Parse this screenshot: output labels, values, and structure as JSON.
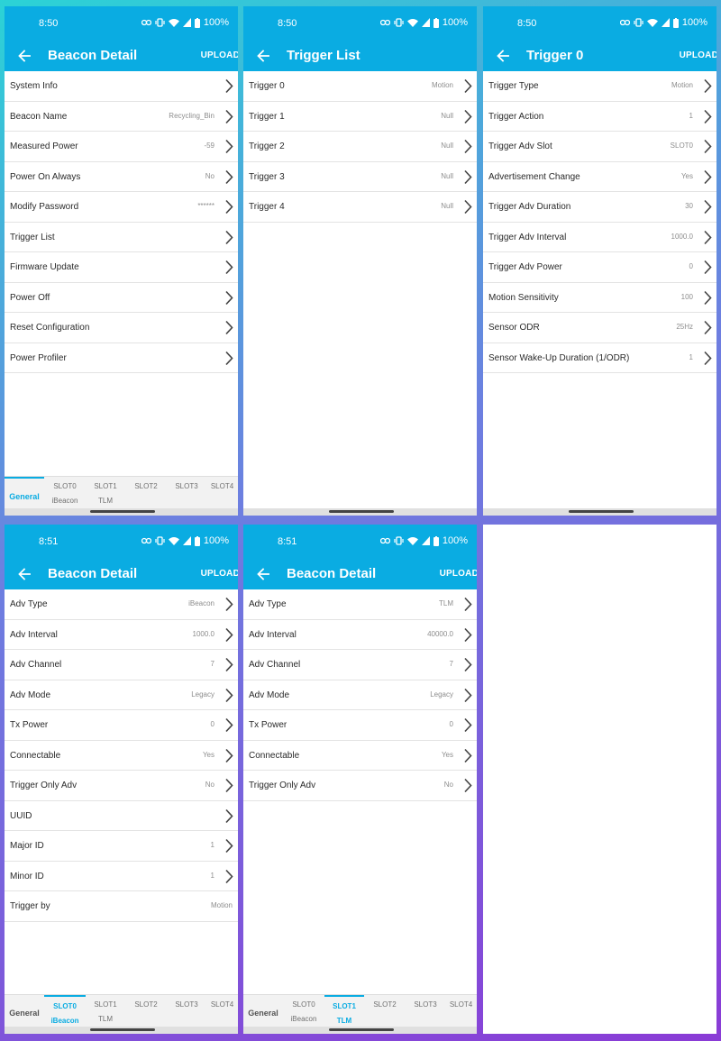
{
  "panels": [
    {
      "time": "8:50",
      "battery": "100%",
      "title": "Beacon Detail",
      "upload": "UPLOAD",
      "rows": [
        {
          "label": "System Info",
          "value": ""
        },
        {
          "label": "Beacon Name",
          "value": "Recycling_Bin"
        },
        {
          "label": "Measured Power",
          "value": "-59"
        },
        {
          "label": "Power On Always",
          "value": "No"
        },
        {
          "label": "Modify Password",
          "value": "******"
        },
        {
          "label": "Trigger List",
          "value": ""
        },
        {
          "label": "Firmware Update",
          "value": ""
        },
        {
          "label": "Power Off",
          "value": ""
        },
        {
          "label": "Reset Configuration",
          "value": ""
        },
        {
          "label": "Power Profiler",
          "value": ""
        }
      ],
      "tabs": [
        {
          "t1": "General",
          "t2": ""
        },
        {
          "t1": "SLOT0",
          "t2": "iBeacon"
        },
        {
          "t1": "SLOT1",
          "t2": "TLM"
        },
        {
          "t1": "SLOT2",
          "t2": ""
        },
        {
          "t1": "SLOT3",
          "t2": ""
        },
        {
          "t1": "SLOT4",
          "t2": ""
        }
      ],
      "active_tab": 0
    },
    {
      "time": "8:50",
      "battery": "100%",
      "title": "Trigger List",
      "upload": "",
      "rows": [
        {
          "label": "Trigger 0",
          "value": "Motion"
        },
        {
          "label": "Trigger 1",
          "value": "Null"
        },
        {
          "label": "Trigger 2",
          "value": "Null"
        },
        {
          "label": "Trigger 3",
          "value": "Null"
        },
        {
          "label": "Trigger 4",
          "value": "Null"
        }
      ]
    },
    {
      "time": "8:50",
      "battery": "100%",
      "title": "Trigger 0",
      "upload": "UPLOAD",
      "rows": [
        {
          "label": "Trigger Type",
          "value": "Motion"
        },
        {
          "label": "Trigger Action",
          "value": "1"
        },
        {
          "label": "Trigger Adv Slot",
          "value": "SLOT0"
        },
        {
          "label": "Advertisement Change",
          "value": "Yes"
        },
        {
          "label": "Trigger Adv Duration",
          "value": "30"
        },
        {
          "label": "Trigger Adv Interval",
          "value": "1000.0"
        },
        {
          "label": "Trigger Adv Power",
          "value": "0"
        },
        {
          "label": "Motion Sensitivity",
          "value": "100"
        },
        {
          "label": "Sensor ODR",
          "value": "25Hz"
        },
        {
          "label": "Sensor Wake-Up Duration (1/ODR)",
          "value": "1"
        }
      ]
    },
    {
      "time": "8:51",
      "battery": "100%",
      "title": "Beacon Detail",
      "upload": "UPLOAD",
      "rows": [
        {
          "label": "Adv Type",
          "value": "iBeacon"
        },
        {
          "label": "Adv Interval",
          "value": "1000.0"
        },
        {
          "label": "Adv Channel",
          "value": "7"
        },
        {
          "label": "Adv Mode",
          "value": "Legacy"
        },
        {
          "label": "Tx Power",
          "value": "0"
        },
        {
          "label": "Connectable",
          "value": "Yes"
        },
        {
          "label": "Trigger Only Adv",
          "value": "No"
        },
        {
          "label": "UUID",
          "value": ""
        },
        {
          "label": "Major ID",
          "value": "1"
        },
        {
          "label": "Minor ID",
          "value": "1"
        },
        {
          "label": "Trigger by",
          "value": "Motion"
        }
      ],
      "tabs": [
        {
          "t1": "General",
          "t2": ""
        },
        {
          "t1": "SLOT0",
          "t2": "iBeacon"
        },
        {
          "t1": "SLOT1",
          "t2": "TLM"
        },
        {
          "t1": "SLOT2",
          "t2": ""
        },
        {
          "t1": "SLOT3",
          "t2": ""
        },
        {
          "t1": "SLOT4",
          "t2": ""
        }
      ],
      "active_tab": 1
    },
    {
      "time": "8:51",
      "battery": "100%",
      "title": "Beacon Detail",
      "upload": "UPLOAD",
      "rows": [
        {
          "label": "Adv Type",
          "value": "TLM"
        },
        {
          "label": "Adv Interval",
          "value": "40000.0"
        },
        {
          "label": "Adv Channel",
          "value": "7"
        },
        {
          "label": "Adv Mode",
          "value": "Legacy"
        },
        {
          "label": "Tx Power",
          "value": "0"
        },
        {
          "label": "Connectable",
          "value": "Yes"
        },
        {
          "label": "Trigger Only Adv",
          "value": "No"
        }
      ],
      "tabs": [
        {
          "t1": "General",
          "t2": ""
        },
        {
          "t1": "SLOT0",
          "t2": "iBeacon"
        },
        {
          "t1": "SLOT1",
          "t2": "TLM"
        },
        {
          "t1": "SLOT2",
          "t2": ""
        },
        {
          "t1": "SLOT3",
          "t2": ""
        },
        {
          "t1": "SLOT4",
          "t2": ""
        }
      ],
      "active_tab": 2
    }
  ],
  "colors": {
    "accent": "#0aace2"
  },
  "icons": [
    "back-arrow-icon",
    "chevron-right-icon",
    "link-icon",
    "vibrate-icon",
    "wifi-icon",
    "signal-icon",
    "battery-icon"
  ]
}
